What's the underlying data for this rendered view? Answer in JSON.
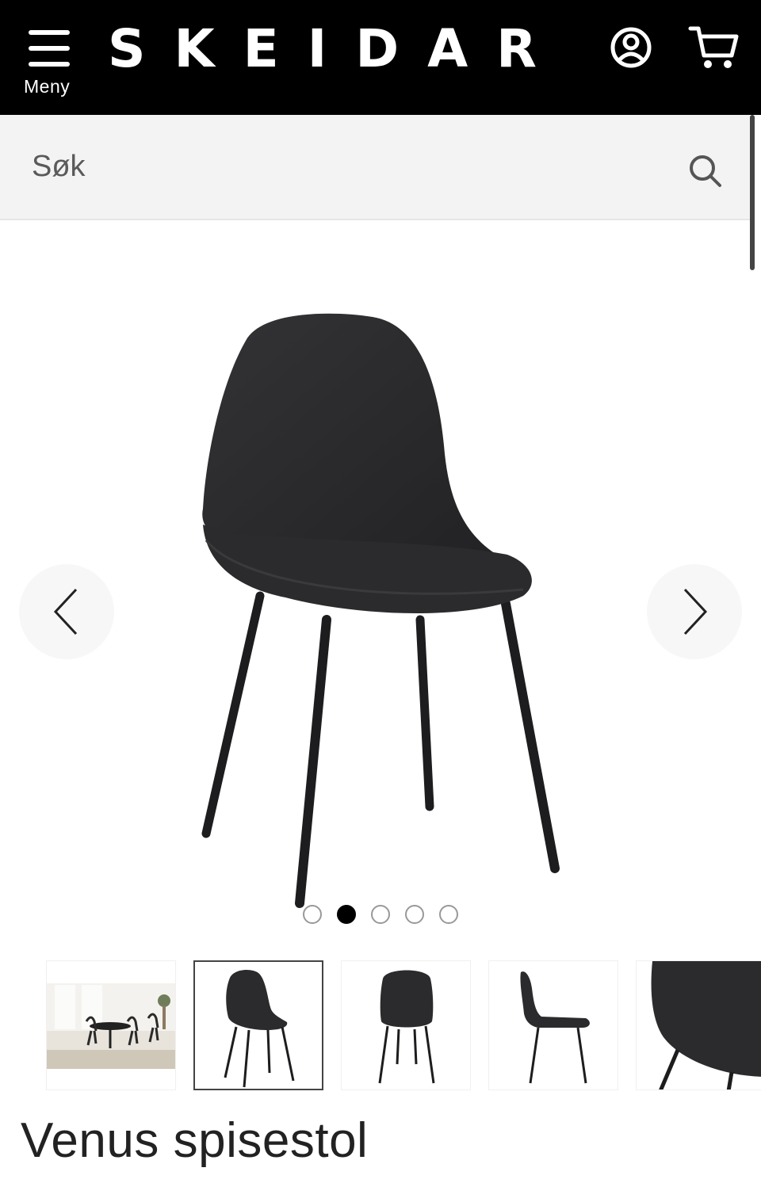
{
  "header": {
    "menu_label": "Meny",
    "logo": "SKEIDAR",
    "icons": [
      "hamburger-menu-icon",
      "account-icon",
      "cart-icon"
    ]
  },
  "search": {
    "placeholder": "Søk"
  },
  "gallery": {
    "image_count": 5,
    "active_index": 1,
    "thumbnail_count": 5,
    "selected_thumbnail": 1
  },
  "product": {
    "title": "Venus spisestol"
  },
  "colors": {
    "header_bg": "#000000",
    "search_bg": "#f3f3f3",
    "chair": "#2b2b2d"
  }
}
